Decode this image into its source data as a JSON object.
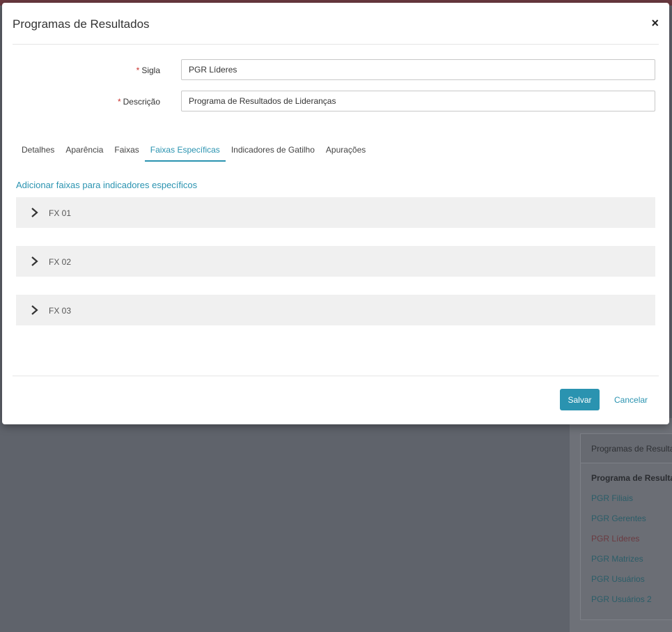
{
  "modal": {
    "title": "Programas de Resultados",
    "close_label": "×"
  },
  "form": {
    "required_mark": "*",
    "sigla_label": "Sigla",
    "sigla_value": "PGR Líderes",
    "descricao_label": "Descrição",
    "descricao_value": "Programa de Resultados de Lideranças"
  },
  "tabs": [
    {
      "label": "Detalhes"
    },
    {
      "label": "Aparência"
    },
    {
      "label": "Faixas"
    },
    {
      "label": "Faixas Específicas",
      "active": true
    },
    {
      "label": "Indicadores de Gatilho"
    },
    {
      "label": "Apurações"
    }
  ],
  "add_link": "Adicionar faixas para indicadores específicos",
  "accordion": [
    {
      "label": "FX 01",
      "icon": "chevron-right-icon"
    },
    {
      "label": "FX 02",
      "icon": "chevron-right-icon"
    },
    {
      "label": "FX 03",
      "icon": "chevron-right-icon"
    }
  ],
  "footer": {
    "save_label": "Salvar",
    "cancel_label": "Cancelar"
  },
  "background": {
    "card_header": "Programas de Resultados",
    "list_header": "Programa de Resultados",
    "items": [
      {
        "label": "PGR Filiais"
      },
      {
        "label": "PGR Gerentes"
      },
      {
        "label": "PGR Líderes",
        "active": true
      },
      {
        "label": "PGR Matrizes"
      },
      {
        "label": "PGR Usuários"
      },
      {
        "label": "PGR Usuários 2"
      }
    ]
  },
  "colors": {
    "accent": "#2a93b0",
    "required": "#c9302c",
    "accordion_bg": "#f0f0f0",
    "overlay": "#5f636b"
  }
}
